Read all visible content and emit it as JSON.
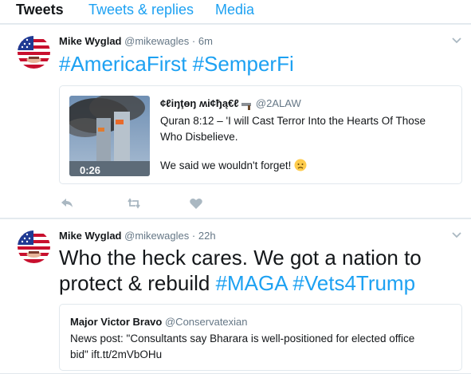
{
  "tabs": [
    {
      "label": "Tweets"
    },
    {
      "label": "Tweets & replies"
    },
    {
      "label": "Media"
    }
  ],
  "tweets": [
    {
      "name": "Mike Wyglad",
      "handle": "@mikewagles",
      "time": "6m",
      "text": [
        "#AmericaFirst",
        "#SemperFi"
      ],
      "quoted": {
        "name": "¢ℓiŋţɵŋ ʍi¢ђą€ℓ",
        "handle": "@2ALAW",
        "lines": [
          "Quran 8:12 – 'I will Cast Terror Into the Hearts Of Those",
          "Who Disbelieve.",
          "We said we wouldn't forget!"
        ],
        "video_duration": "0:26"
      }
    },
    {
      "name": "Mike Wyglad",
      "handle": "@mikewagles",
      "time": "22h",
      "line1": "Who the heck cares. We got a nation to",
      "line2_plain": "protect & rebuild ",
      "hashtag1": "#MAGA",
      "hashtag2": "#Vets4Trump",
      "quoted": {
        "name": "Major Victor Bravo",
        "handle": "@Conservatexian",
        "line1": "News post: \"Consultants say Bharara is well-positioned for elected office",
        "line2": "bid\" ift.tt/2mVbOHu"
      }
    }
  ],
  "icons": {
    "reply": "reply-icon",
    "retweet": "retweet-icon",
    "like": "heart-icon",
    "more": "chevron-down-icon",
    "emoji": "disappointed-face-emoji",
    "gun": "gun-emoji"
  },
  "colors": {
    "accent": "#1da1f2",
    "text": "#14171a",
    "muted": "#657786",
    "border": "#e1e8ed",
    "background": "#e6ecf0"
  }
}
